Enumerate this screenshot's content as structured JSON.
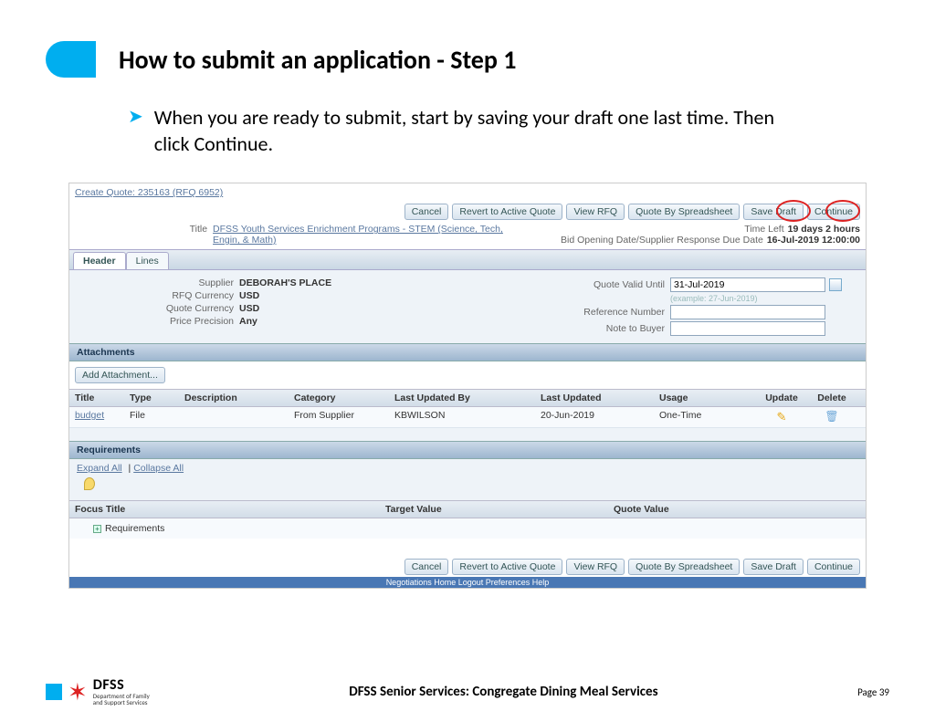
{
  "slide": {
    "title": "How to submit an application  - Step 1",
    "bullet": "When you are ready to submit, start by saving your draft one last time. Then click Continue."
  },
  "app": {
    "breadcrumb": "Create Quote: 235163 (RFQ 6952)",
    "buttons": {
      "cancel": "Cancel",
      "revert": "Revert to Active Quote",
      "viewrfq": "View RFQ",
      "spreadsheet": "Quote By Spreadsheet",
      "savedraft": "Save Draft",
      "continue": "Continue",
      "addattachment": "Add Attachment..."
    },
    "meta": {
      "title_label": "Title",
      "title_value": "DFSS Youth Services Enrichment Programs - STEM (Science, Tech, Engin, & Math)",
      "timeleft_label": "Time Left",
      "timeleft_value": "19 days 2 hours",
      "due_label": "Bid Opening Date/Supplier Response Due Date",
      "due_value": "16-Jul-2019 12:00:00"
    },
    "tabs": {
      "header": "Header",
      "lines": "Lines"
    },
    "form": {
      "supplier_label": "Supplier",
      "supplier_value": "DEBORAH'S PLACE",
      "rfqcur_label": "RFQ Currency",
      "rfqcur_value": "USD",
      "quotecur_label": "Quote Currency",
      "quotecur_value": "USD",
      "priceprec_label": "Price Precision",
      "priceprec_value": "Any",
      "valid_label": "Quote Valid Until",
      "valid_value": "31-Jul-2019",
      "valid_example": "(example: 27-Jun-2019)",
      "ref_label": "Reference Number",
      "note_label": "Note to Buyer"
    },
    "sections": {
      "attachments": "Attachments",
      "requirements": "Requirements"
    },
    "att_cols": {
      "title": "Title",
      "type": "Type",
      "desc": "Description",
      "cat": "Category",
      "upby": "Last Updated By",
      "up": "Last Updated",
      "usage": "Usage",
      "update": "Update",
      "delete": "Delete"
    },
    "att_row": {
      "title": "budget",
      "type": "File",
      "desc": "",
      "cat": "From Supplier",
      "upby": "KBWILSON",
      "up": "20-Jun-2019",
      "usage": "One-Time"
    },
    "req_tools": {
      "expand": "Expand All",
      "collapse": "Collapse All"
    },
    "req_cols": {
      "focus": "Focus Title",
      "target": "Target Value",
      "quote": "Quote Value"
    },
    "req_row": {
      "title": "Requirements"
    },
    "bottom_note": "Negotiations  Home  Logout  Preferences  Help"
  },
  "footer": {
    "dfss": "DFSS",
    "dept1": "Department of Family",
    "dept2": "and Support Services",
    "center": "DFSS Senior Services: Congregate Dining Meal Services",
    "page": "Page 39"
  }
}
